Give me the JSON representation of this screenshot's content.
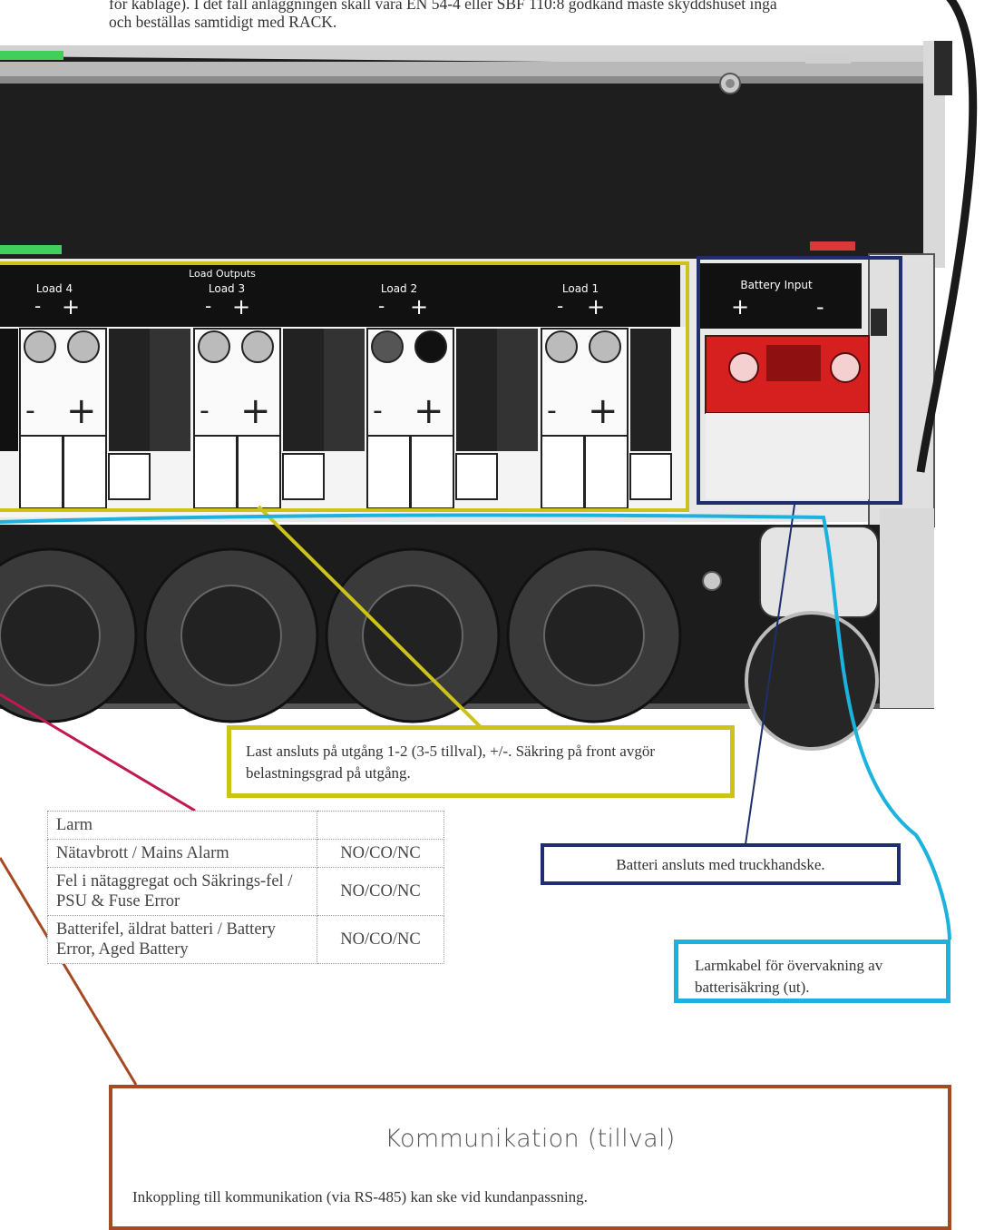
{
  "intro_text": {
    "line1": "för kablage). I det fall anläggningen skall vara EN 54-4 eller SBF 110:8 godkänd måste skyddshuset ingå",
    "line2": "och beställas samtidigt med RACK."
  },
  "panel_labels": {
    "load_outputs": "Load Outputs",
    "load4": "Load 4",
    "load3": "Load 3",
    "load2": "Load 2",
    "load1": "Load 1",
    "battery_input": "Battery Input",
    "minus": "-",
    "plus": "+"
  },
  "callouts": {
    "load": "Last ansluts på utgång 1-2 (3-5 tillval), +/-. Säkring på front avgör belastningsgrad på utgång.",
    "battery": "Batteri ansluts med truckhandske.",
    "alarm_cable": "Larmkabel för övervakning av batterisäkring (ut).",
    "comm_title": "Kommunikation (tillval)",
    "comm_text": "Inkoppling till kommunikation (via RS-485) kan ske vid kundanpassning."
  },
  "alarm_table": {
    "header": "Larm",
    "rows": [
      {
        "label": "Nätavbrott / Mains Alarm",
        "value": "NO/CO/NC"
      },
      {
        "label": "Fel i nätaggregat och Säkrings-fel / PSU & Fuse Error",
        "value": "NO/CO/NC"
      },
      {
        "label": "Batterifel, äldrat batteri / Battery Error, Aged Battery",
        "value": "NO/CO/NC"
      }
    ]
  },
  "colors": {
    "load_callout": "#cdc21a",
    "battery_callout": "#1f2e6e",
    "alarm_cable_callout": "#1bb3de",
    "comm_callout": "#a54a24",
    "alarm_leader": "#c0194d",
    "fuse": "#d62020"
  }
}
